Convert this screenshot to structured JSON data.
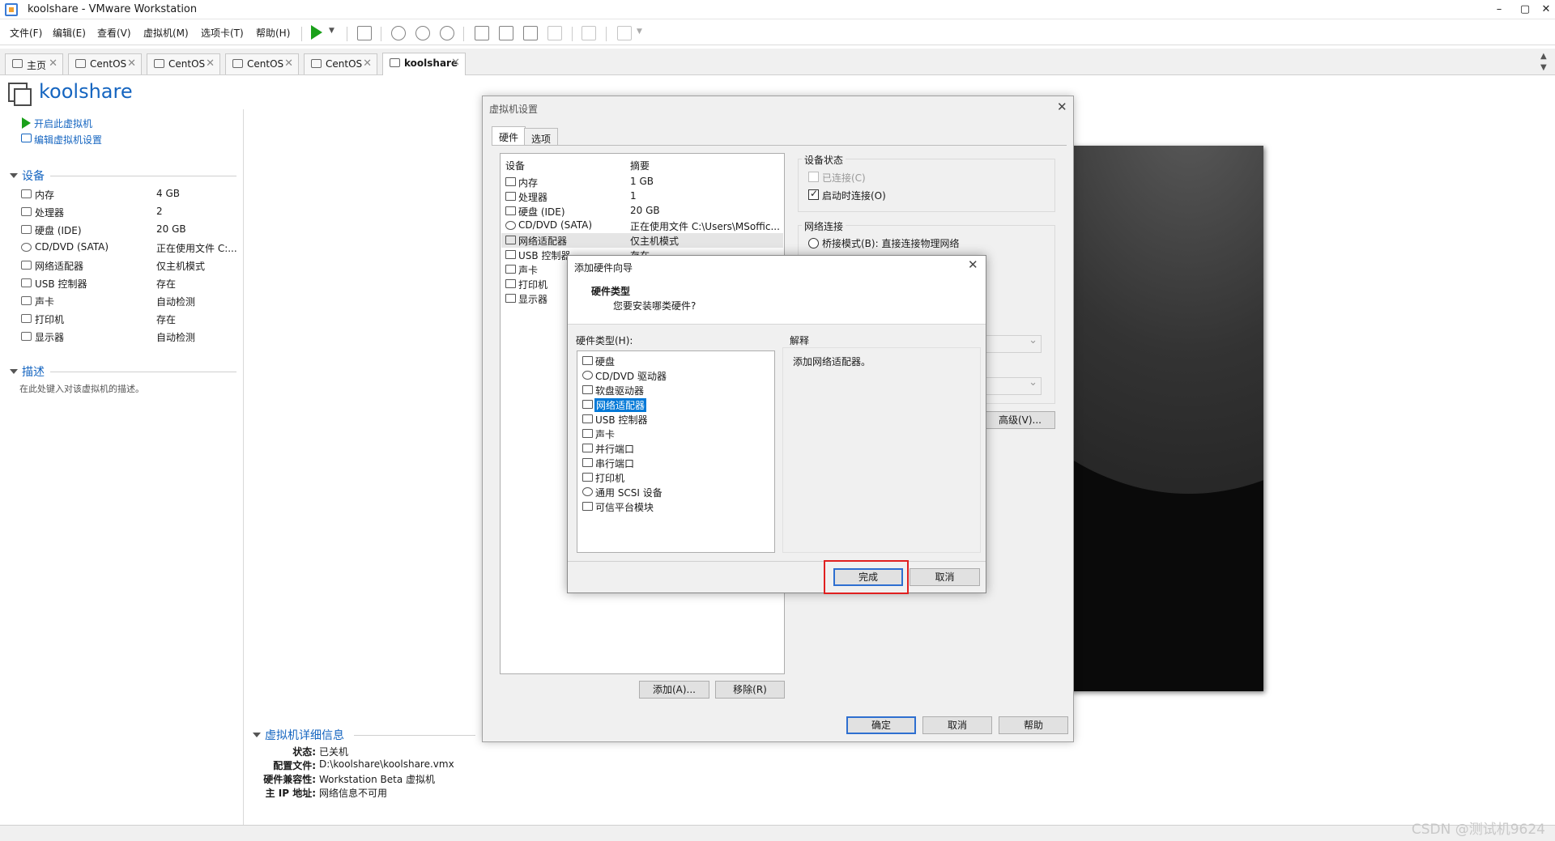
{
  "window": {
    "title": "koolshare - VMware Workstation",
    "minimize": "–",
    "maximize": "▢",
    "close": "✕"
  },
  "menu": [
    "文件(F)",
    "编辑(E)",
    "查看(V)",
    "虚拟机(M)",
    "选项卡(T)",
    "帮助(H)"
  ],
  "tabs": [
    {
      "label": "主页",
      "icon": "home-icon"
    },
    {
      "label": "CentOS",
      "icon": "vm-icon"
    },
    {
      "label": "CentOS",
      "icon": "vm-icon"
    },
    {
      "label": "CentOS",
      "icon": "vm-icon"
    },
    {
      "label": "CentOS",
      "icon": "vm-icon"
    },
    {
      "label": "koolshare",
      "icon": "vm-icon"
    }
  ],
  "tab_close": "✕",
  "vm": {
    "name": "koolshare",
    "power_on": "开启此虚拟机",
    "edit_settings": "编辑虚拟机设置",
    "devices_header": "设备",
    "devices": [
      {
        "name": "内存",
        "value": "4 GB",
        "icon": "memory-icon"
      },
      {
        "name": "处理器",
        "value": "2",
        "icon": "cpu-icon"
      },
      {
        "name": "硬盘 (IDE)",
        "value": "20 GB",
        "icon": "disk-icon"
      },
      {
        "name": "CD/DVD (SATA)",
        "value": "正在使用文件 C:...",
        "icon": "cd-icon"
      },
      {
        "name": "网络适配器",
        "value": "仅主机模式",
        "icon": "network-icon"
      },
      {
        "name": "USB 控制器",
        "value": "存在",
        "icon": "usb-icon"
      },
      {
        "name": "声卡",
        "value": "自动检测",
        "icon": "sound-icon"
      },
      {
        "name": "打印机",
        "value": "存在",
        "icon": "printer-icon"
      },
      {
        "name": "显示器",
        "value": "自动检测",
        "icon": "display-icon"
      }
    ],
    "desc_header": "描述",
    "desc_placeholder": "在此处键入对该虚拟机的描述。",
    "details_header": "虚拟机详细信息",
    "details": [
      {
        "key": "状态:",
        "value": "已关机"
      },
      {
        "key": "配置文件:",
        "value": "D:\\koolshare\\koolshare.vmx"
      },
      {
        "key": "硬件兼容性:",
        "value": "Workstation Beta 虚拟机"
      },
      {
        "key": "主 IP 地址:",
        "value": "网络信息不可用"
      }
    ]
  },
  "settings_dialog": {
    "title": "虚拟机设置",
    "tabs": [
      "硬件",
      "选项"
    ],
    "col_device": "设备",
    "col_summary": "摘要",
    "devices": [
      {
        "name": "内存",
        "summary": "1 GB"
      },
      {
        "name": "处理器",
        "summary": "1"
      },
      {
        "name": "硬盘 (IDE)",
        "summary": "20 GB"
      },
      {
        "name": "CD/DVD (SATA)",
        "summary": "正在使用文件 C:\\Users\\MSoffic..."
      },
      {
        "name": "网络适配器",
        "summary": "仅主机模式"
      },
      {
        "name": "USB 控制器",
        "summary": "存在"
      },
      {
        "name": "声卡",
        "summary": ""
      },
      {
        "name": "打印机",
        "summary": ""
      },
      {
        "name": "显示器",
        "summary": ""
      }
    ],
    "device_status": "设备状态",
    "connected": "已连接(C)",
    "connect_on_power": "启动时连接(O)",
    "network_connection": "网络连接",
    "bridged": "桥接模式(B): 直接连接物理网络",
    "advanced": "高级(V)...",
    "add": "添加(A)...",
    "remove": "移除(R)",
    "ok": "确定",
    "cancel": "取消",
    "help": "帮助"
  },
  "wizard": {
    "title": "添加硬件向导",
    "heading": "硬件类型",
    "subheading": "您要安装哪类硬件?",
    "list_label": "硬件类型(H):",
    "explain_label": "解释",
    "explain_text": "添加网络适配器。",
    "items": [
      {
        "label": "硬盘",
        "icon": "disk-icon"
      },
      {
        "label": "CD/DVD 驱动器",
        "icon": "cd-icon"
      },
      {
        "label": "软盘驱动器",
        "icon": "floppy-icon"
      },
      {
        "label": "网络适配器",
        "icon": "network-icon"
      },
      {
        "label": "USB 控制器",
        "icon": "usb-icon"
      },
      {
        "label": "声卡",
        "icon": "sound-icon"
      },
      {
        "label": "并行端口",
        "icon": "parallel-port-icon"
      },
      {
        "label": "串行端口",
        "icon": "serial-port-icon"
      },
      {
        "label": "打印机",
        "icon": "printer-icon"
      },
      {
        "label": "通用 SCSI 设备",
        "icon": "scsi-icon"
      },
      {
        "label": "可信平台模块",
        "icon": "tpm-icon"
      }
    ],
    "selected_index": 3,
    "finish": "完成",
    "cancel": "取消"
  },
  "watermark": "CSDN @测试机9624"
}
